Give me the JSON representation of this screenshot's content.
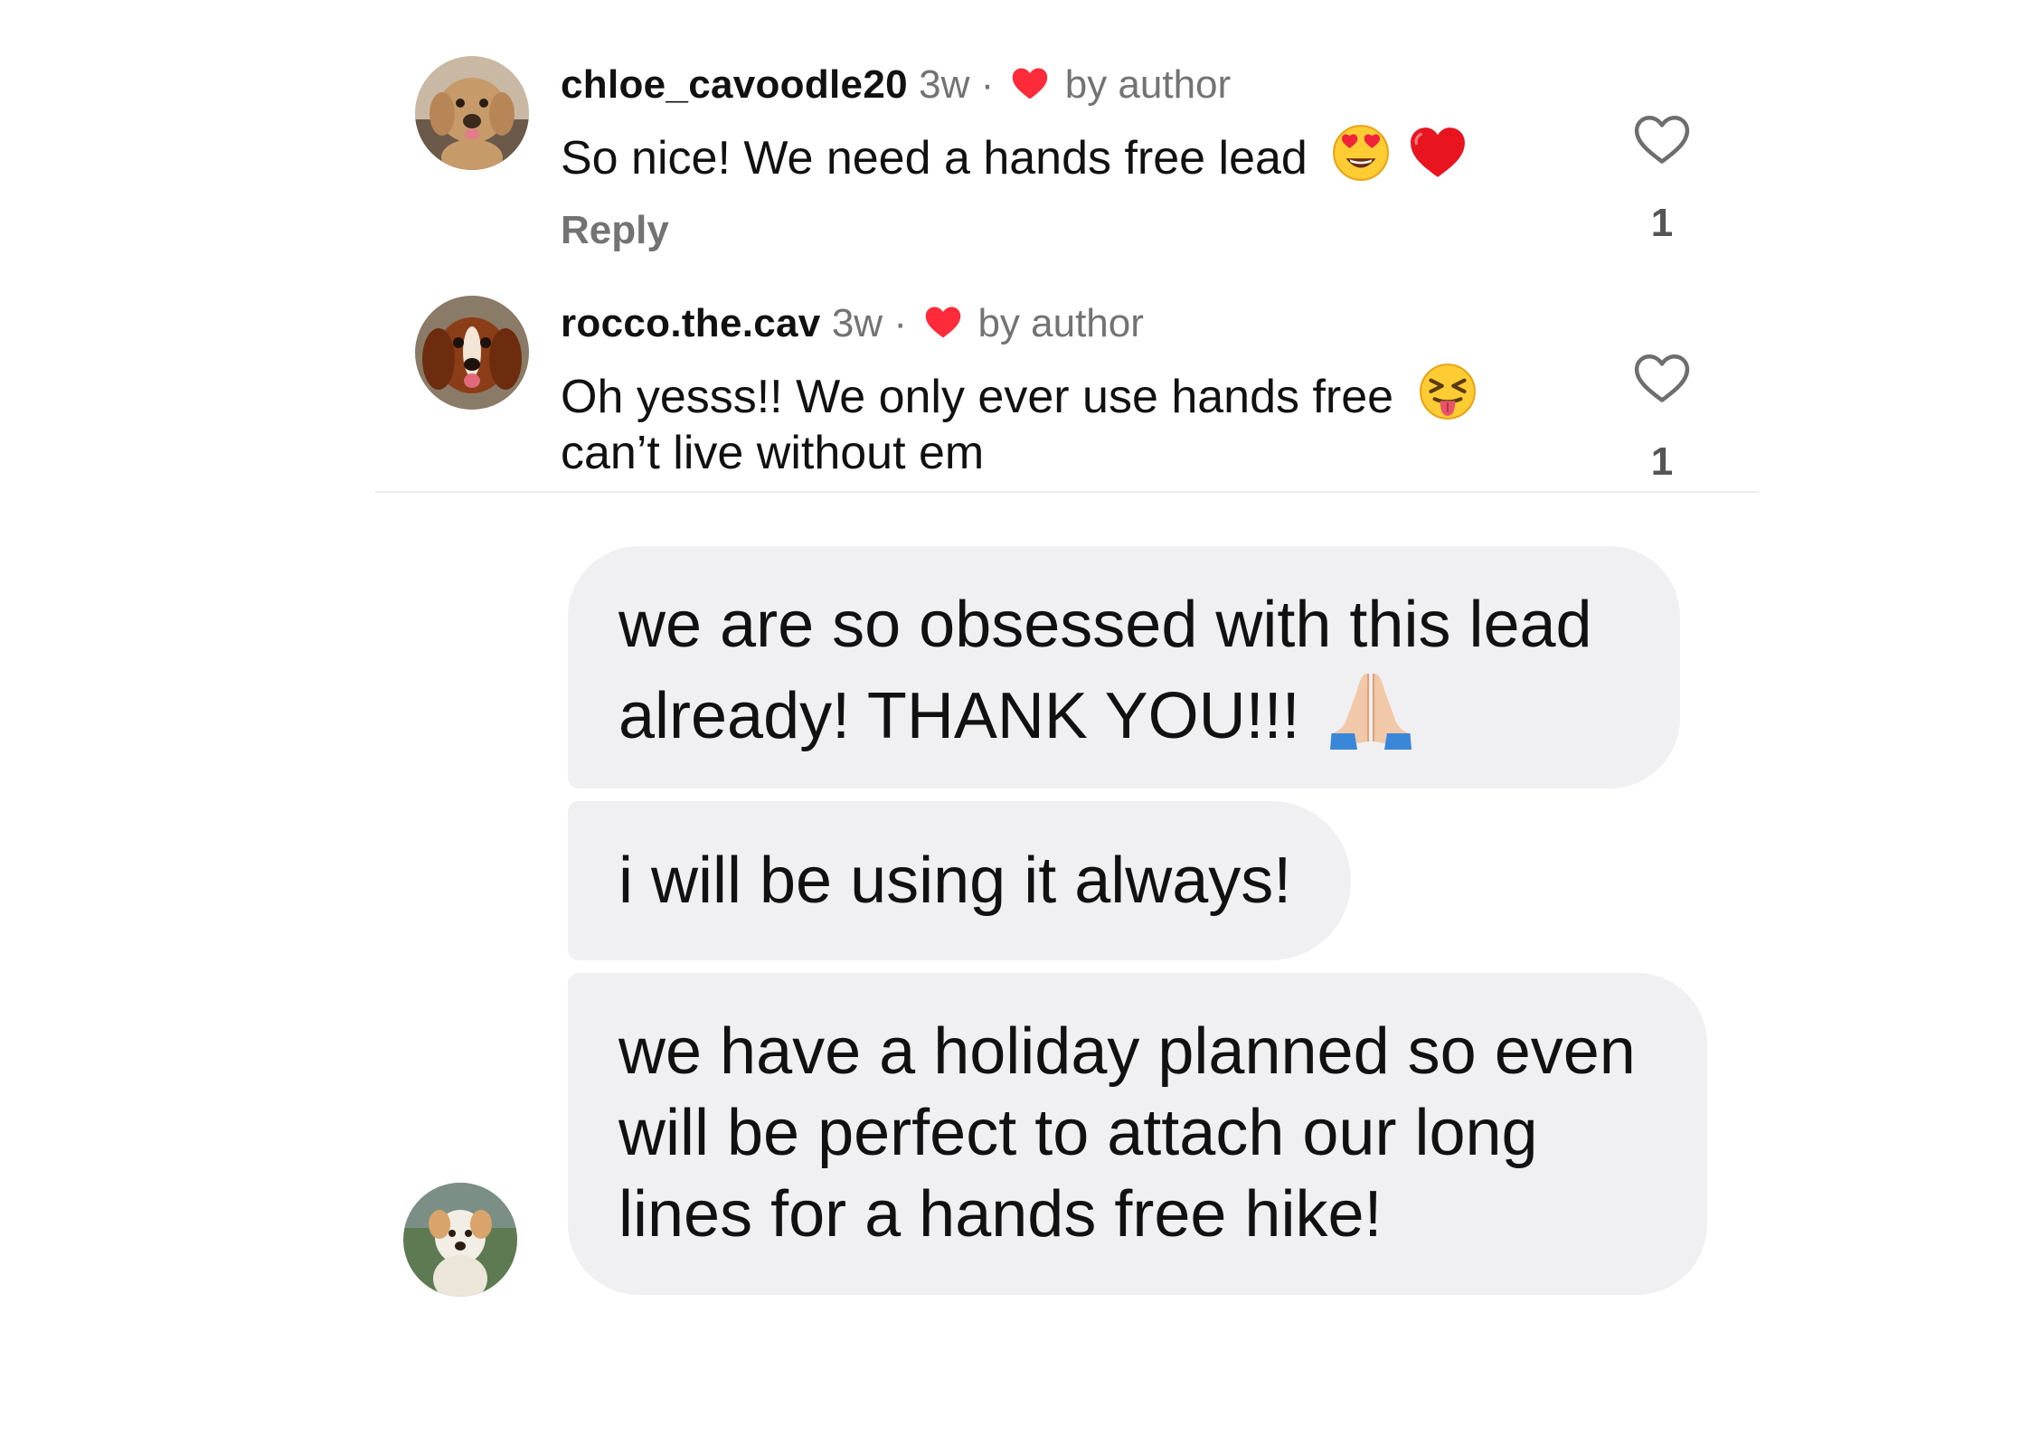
{
  "comments": [
    {
      "username": "chloe_cavoodle20",
      "time": "3w",
      "separator": "·",
      "liked_by": "by author",
      "text": "So nice! We need a hands free lead",
      "emojis": [
        "heart-eyes-emoji",
        "red-heart-emoji"
      ],
      "reply_label": "Reply",
      "like_count": "1",
      "avatar": "cavoodle-avatar"
    },
    {
      "username": "rocco.the.cav",
      "time": "3w",
      "separator": "·",
      "liked_by": "by author",
      "text_line1": "Oh yesss!! We only ever use hands free",
      "text_line2": "can’t live without em",
      "emojis": [
        "squinting-tongue-emoji"
      ],
      "like_count": "1",
      "avatar": "cavalier-avatar"
    }
  ],
  "messages": [
    {
      "line1": "we are so obsessed with this lead",
      "line2": "already! THANK YOU!!!",
      "emoji": "folded-hands-emoji"
    },
    {
      "line1": "i will be using it always!"
    },
    {
      "line1": "we have a holiday planned so even",
      "line2": "will be perfect to attach our long",
      "line3": "lines for a hands free hike!"
    }
  ],
  "sender_avatar": "golden-dog-avatar",
  "colors": {
    "text": "#111111",
    "meta": "#737373",
    "author_heart": "#ff2a3a",
    "bubble": "#f0f0f2",
    "divider": "#ececec"
  }
}
